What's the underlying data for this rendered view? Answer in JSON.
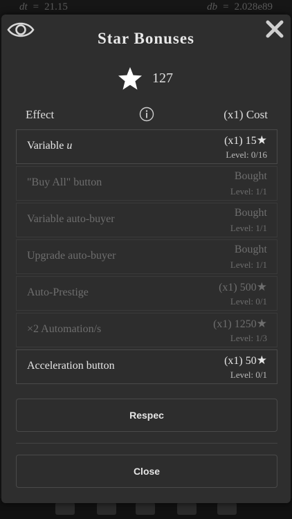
{
  "topbar": {
    "left_var": "dt",
    "left_eq": "=",
    "left_value": "21.15",
    "right_var": "db",
    "right_eq": "=",
    "right_value": "2.028e89"
  },
  "modal": {
    "title": "Star Bonuses",
    "star_count": "127",
    "header": {
      "effect": "Effect",
      "cost": "(x1) Cost"
    },
    "items": [
      {
        "name": "Variable ",
        "name_var": "u",
        "cost": "(x1) 15",
        "level": "Level: 0/16",
        "star": "★",
        "enabled": true
      },
      {
        "name": "\"Buy All\" button",
        "cost": "Bought",
        "level": "Level: 1/1",
        "enabled": false
      },
      {
        "name": "Variable auto-buyer",
        "cost": "Bought",
        "level": "Level: 1/1",
        "enabled": false
      },
      {
        "name": "Upgrade auto-buyer",
        "cost": "Bought",
        "level": "Level: 1/1",
        "enabled": false
      },
      {
        "name": "Auto-Prestige",
        "cost": "(x1) 500",
        "level": "Level: 0/1",
        "star": "★",
        "enabled": false
      },
      {
        "name": "×2 Automation/s",
        "cost": "(x1) 1250",
        "level": "Level: 1/3",
        "star": "★",
        "enabled": false
      },
      {
        "name": "Acceleration button",
        "cost": "(x1) 50",
        "level": "Level: 0/1",
        "star": "★",
        "enabled": true
      }
    ],
    "respec_label": "Respec",
    "close_label": "Close"
  },
  "colors": {
    "background": "#1a1a1a",
    "modal": "#2e2e2e",
    "border": "#4a4a4a",
    "text": "#e6e6e6",
    "disabled_text": "#6e6e6e"
  },
  "icons": {
    "top_left": "eye-icon",
    "top_right": "close-icon",
    "header_info": "info-icon",
    "star": "star-icon"
  }
}
